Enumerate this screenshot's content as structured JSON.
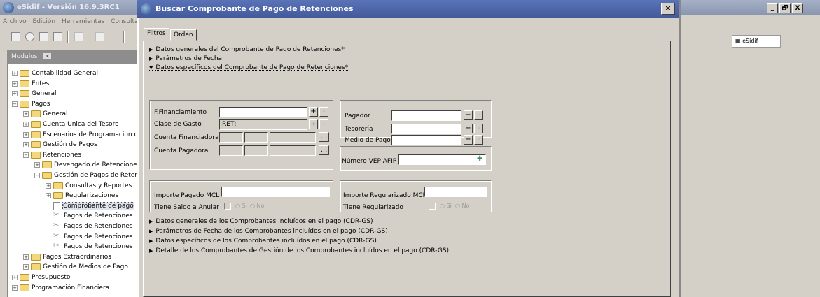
{
  "main_window": {
    "title": "eSidif - Versión 16.9.3RC1"
  },
  "menu": [
    "Archivo",
    "Edición",
    "Herramientas",
    "Consulta"
  ],
  "modules_panel": {
    "title": "Modulos",
    "close": "✕"
  },
  "tree": [
    {
      "label": "Contabilidad General",
      "level": 0,
      "type": "folder",
      "exp": "+"
    },
    {
      "label": "Entes",
      "level": 0,
      "type": "folder",
      "exp": "+"
    },
    {
      "label": "General",
      "level": 0,
      "type": "folder",
      "exp": "+"
    },
    {
      "label": "Pagos",
      "level": 0,
      "type": "folder",
      "exp": "−"
    },
    {
      "label": "General",
      "level": 1,
      "type": "folder",
      "exp": "+"
    },
    {
      "label": "Cuenta Unica del Tesoro",
      "level": 1,
      "type": "folder",
      "exp": "+"
    },
    {
      "label": "Escenarios de Programacion de",
      "level": 1,
      "type": "folder",
      "exp": "+"
    },
    {
      "label": "Gestión de Pagos",
      "level": 1,
      "type": "folder",
      "exp": "+"
    },
    {
      "label": "Retenciones",
      "level": 1,
      "type": "folder",
      "exp": "−"
    },
    {
      "label": "Devengado de Retencione",
      "level": 2,
      "type": "folder",
      "exp": "+"
    },
    {
      "label": "Gestión de Pagos de Reter",
      "level": 2,
      "type": "folder",
      "exp": "−"
    },
    {
      "label": "Consultas y Reportes",
      "level": 3,
      "type": "folder",
      "exp": "+"
    },
    {
      "label": "Regularizaciones",
      "level": 3,
      "type": "folder",
      "exp": "+"
    },
    {
      "label": "Comprobante de pago",
      "level": 3,
      "type": "leaf",
      "exp": "",
      "selected": true
    },
    {
      "label": "Pagos de Retenciones",
      "level": 3,
      "type": "tool",
      "exp": ""
    },
    {
      "label": "Pagos de Retenciones",
      "level": 3,
      "type": "tool",
      "exp": ""
    },
    {
      "label": "Pagos de Retenciones",
      "level": 3,
      "type": "tool",
      "exp": ""
    },
    {
      "label": "Pagos de Retenciones",
      "level": 3,
      "type": "tool",
      "exp": ""
    },
    {
      "label": "Pagos Extraordinarios",
      "level": 1,
      "type": "folder",
      "exp": "+"
    },
    {
      "label": "Gestión de Medios de Pago",
      "level": 1,
      "type": "folder",
      "exp": "+"
    },
    {
      "label": "Presupuesto",
      "level": 0,
      "type": "folder",
      "exp": "+"
    },
    {
      "label": "Programación Financiera",
      "level": 0,
      "type": "folder",
      "exp": "+"
    }
  ],
  "dialog": {
    "title": "Buscar Comprobante de Pago de Retenciones",
    "close": "×",
    "tabs": [
      "Filtros",
      "Orden"
    ],
    "sections_top": [
      "Datos generales del Comprobante de Pago de Retenciones*",
      "Parámetros de Fecha",
      "Datos específicos del Comprobante de Pago de Retenciones*"
    ],
    "arrows_top": [
      "▶",
      "▶",
      "▼"
    ],
    "fields": {
      "f_financiamiento": "F.Financiamiento",
      "clase_gasto": "Clase de Gasto",
      "clase_gasto_value": "RET;",
      "cuenta_financiadora": "Cuenta Financiadora",
      "cuenta_pagadora": "Cuenta Pagadora",
      "pagador": "Pagador",
      "tesoreria": "Tesorería",
      "medio_pago": "Medio de Pago",
      "numero_vep": "Número VEP AFIP",
      "importe_pagado": "Importe Pagado  MCL",
      "tiene_saldo": "Tiene Saldo a Anular",
      "importe_regularizado": "Importe Regularizado  MCL",
      "tiene_regularizado": "Tiene Regularizado",
      "si": "Si",
      "no": "No",
      "plus": "+",
      "minus": "-",
      "ellipsis": "..."
    },
    "sections_bottom": [
      "Datos generales de los Comprobantes incluídos en el pago (CDR-GS)",
      "Parámetros de Fecha de los Comprobantes incluídos en el pago (CDR-GS)",
      "Datos específicos de los Comprobantes incluídos en el pago (CDR-GS)",
      "Detalle de los Comprobantes de Gestión de los Comprobantes incluídos en el pago (CDR-GS)"
    ]
  },
  "right_panel": {
    "tab": "eSidif",
    "min": "_",
    "restore": "🗗",
    "close": "X"
  }
}
